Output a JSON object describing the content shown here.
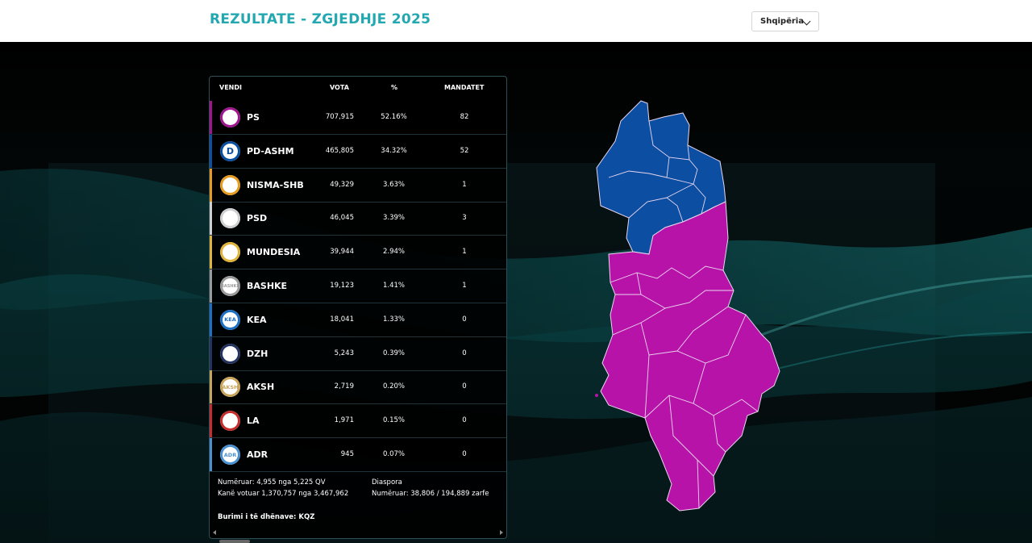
{
  "header": {
    "title": "REZULTATE - ZGJEDHJE 2025",
    "country_selector": {
      "selected": "Shqipëria"
    }
  },
  "table": {
    "columns": [
      "VENDI",
      "VOTA",
      "%",
      "MANDATET"
    ],
    "rows": [
      {
        "party": "PS",
        "votes": "707,915",
        "percent": "52.16%",
        "seats": "82",
        "color": "#a0158f",
        "logo": "ps-logo"
      },
      {
        "party": "PD-ASHM",
        "votes": "465,805",
        "percent": "34.32%",
        "seats": "52",
        "color": "#0b4fa0",
        "logo": "pd-logo"
      },
      {
        "party": "NISMA-SHB",
        "votes": "49,329",
        "percent": "3.63%",
        "seats": "1",
        "color": "#e69a1f",
        "logo": "nisma-logo"
      },
      {
        "party": "PSD",
        "votes": "46,045",
        "percent": "3.39%",
        "seats": "3",
        "color": "#cfcfcf",
        "logo": "psd-logo"
      },
      {
        "party": "MUNDESIA",
        "votes": "39,944",
        "percent": "2.94%",
        "seats": "1",
        "color": "#e0b43a",
        "logo": "mundesia-logo"
      },
      {
        "party": "BASHKE",
        "votes": "19,123",
        "percent": "1.41%",
        "seats": "1",
        "color": "#9a9a9a",
        "logo": "bashke-logo"
      },
      {
        "party": "KEA",
        "votes": "18,041",
        "percent": "1.33%",
        "seats": "0",
        "color": "#1d6fc2",
        "logo": "kea-logo"
      },
      {
        "party": "DZH",
        "votes": "5,243",
        "percent": "0.39%",
        "seats": "0",
        "color": "#22335f",
        "logo": "dzh-logo"
      },
      {
        "party": "AKSH",
        "votes": "2,719",
        "percent": "0.20%",
        "seats": "0",
        "color": "#c8a45a",
        "logo": "aksh-logo"
      },
      {
        "party": "LA",
        "votes": "1,971",
        "percent": "0.15%",
        "seats": "0",
        "color": "#c62d2d",
        "logo": "la-logo"
      },
      {
        "party": "ADR",
        "votes": "945",
        "percent": "0.07%",
        "seats": "0",
        "color": "#4a90d0",
        "logo": "adr-logo"
      }
    ]
  },
  "footer": {
    "counted": "Numëruar: 4,955 nga 5,225 QV",
    "voted": "Kanë votuar 1,370,757 nga 3,467,962",
    "diaspora_title": "Diaspora",
    "diaspora_counted": "Numëruar: 38,806 / 194,889 zarfe",
    "source": "Burimi i të dhënave: KQZ"
  },
  "map": {
    "colors": {
      "north": "#0c4ea2",
      "south": "#b813a8",
      "border": "#e9d6ef"
    }
  },
  "logo_glyphs": {
    "PS": "",
    "PD-ASHM": "D",
    "NISMA-SHB": "",
    "PSD": "",
    "MUNDESIA": "",
    "BASHKE": "BASHKE",
    "KEA": "KEA",
    "DZH": "",
    "AKSH": "AKSH",
    "LA": "",
    "ADR": "ADR"
  }
}
